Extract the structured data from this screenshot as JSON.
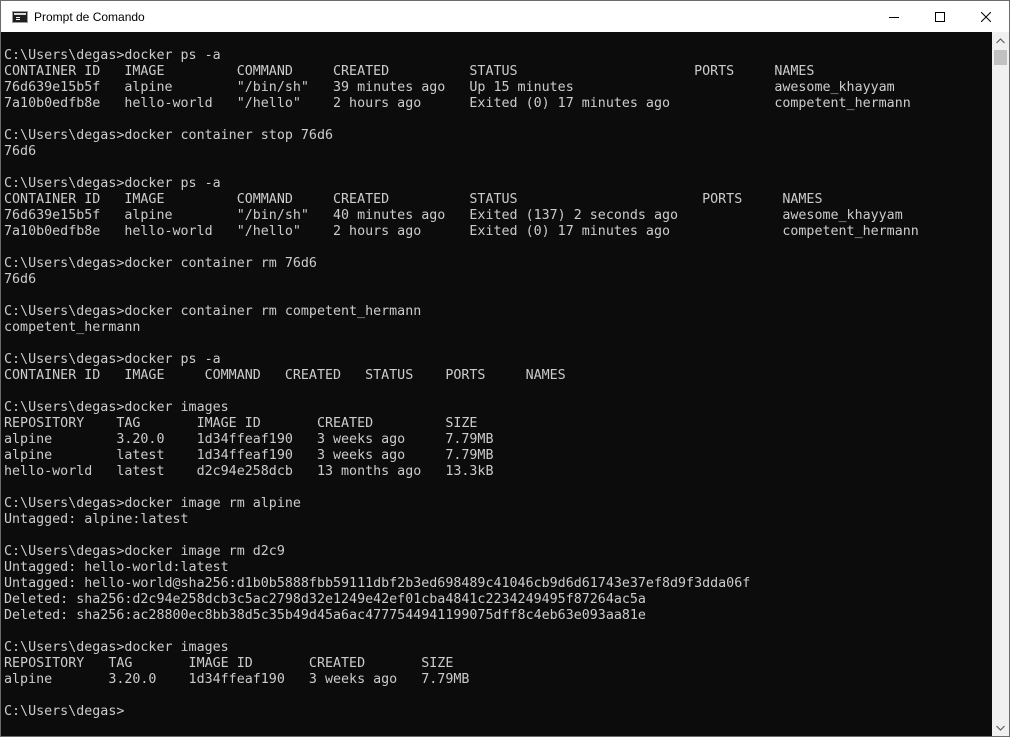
{
  "window": {
    "title": "Prompt de Comando"
  },
  "console": {
    "lines": [
      "C:\\Users\\degas>docker ps -a",
      "CONTAINER ID   IMAGE         COMMAND     CREATED          STATUS                      PORTS     NAMES",
      "76d639e15b5f   alpine        \"/bin/sh\"   39 minutes ago   Up 15 minutes                         awesome_khayyam",
      "7a10b0edfb8e   hello-world   \"/hello\"    2 hours ago      Exited (0) 17 minutes ago             competent_hermann",
      "",
      "C:\\Users\\degas>docker container stop 76d6",
      "76d6",
      "",
      "C:\\Users\\degas>docker ps -a",
      "CONTAINER ID   IMAGE         COMMAND     CREATED          STATUS                       PORTS     NAMES",
      "76d639e15b5f   alpine        \"/bin/sh\"   40 minutes ago   Exited (137) 2 seconds ago             awesome_khayyam",
      "7a10b0edfb8e   hello-world   \"/hello\"    2 hours ago      Exited (0) 17 minutes ago              competent_hermann",
      "",
      "C:\\Users\\degas>docker container rm 76d6",
      "76d6",
      "",
      "C:\\Users\\degas>docker container rm competent_hermann",
      "competent_hermann",
      "",
      "C:\\Users\\degas>docker ps -a",
      "CONTAINER ID   IMAGE     COMMAND   CREATED   STATUS    PORTS     NAMES",
      "",
      "C:\\Users\\degas>docker images",
      "REPOSITORY    TAG       IMAGE ID       CREATED         SIZE",
      "alpine        3.20.0    1d34ffeaf190   3 weeks ago     7.79MB",
      "alpine        latest    1d34ffeaf190   3 weeks ago     7.79MB",
      "hello-world   latest    d2c94e258dcb   13 months ago   13.3kB",
      "",
      "C:\\Users\\degas>docker image rm alpine",
      "Untagged: alpine:latest",
      "",
      "C:\\Users\\degas>docker image rm d2c9",
      "Untagged: hello-world:latest",
      "Untagged: hello-world@sha256:d1b0b5888fbb59111dbf2b3ed698489c41046cb9d6d61743e37ef8d9f3dda06f",
      "Deleted: sha256:d2c94e258dcb3c5ac2798d32e1249e42ef01cba4841c2234249495f87264ac5a",
      "Deleted: sha256:ac28800ec8bb38d5c35b49d45a6ac4777544941199075dff8c4eb63e093aa81e",
      "",
      "C:\\Users\\degas>docker images",
      "REPOSITORY   TAG       IMAGE ID       CREATED       SIZE",
      "alpine       3.20.0    1d34ffeaf190   3 weeks ago   7.79MB",
      "",
      "C:\\Users\\degas>"
    ]
  },
  "icons": {
    "app": "command-prompt-icon",
    "minimize": "minimize-icon",
    "maximize": "maximize-icon",
    "close": "close-icon",
    "scroll_up": "scroll-up-arrow-icon",
    "scroll_down": "scroll-down-arrow-icon"
  },
  "colors": {
    "console_background": "#0c0c0c",
    "console_text": "#cccccc",
    "titlebar_background": "#ffffff"
  }
}
